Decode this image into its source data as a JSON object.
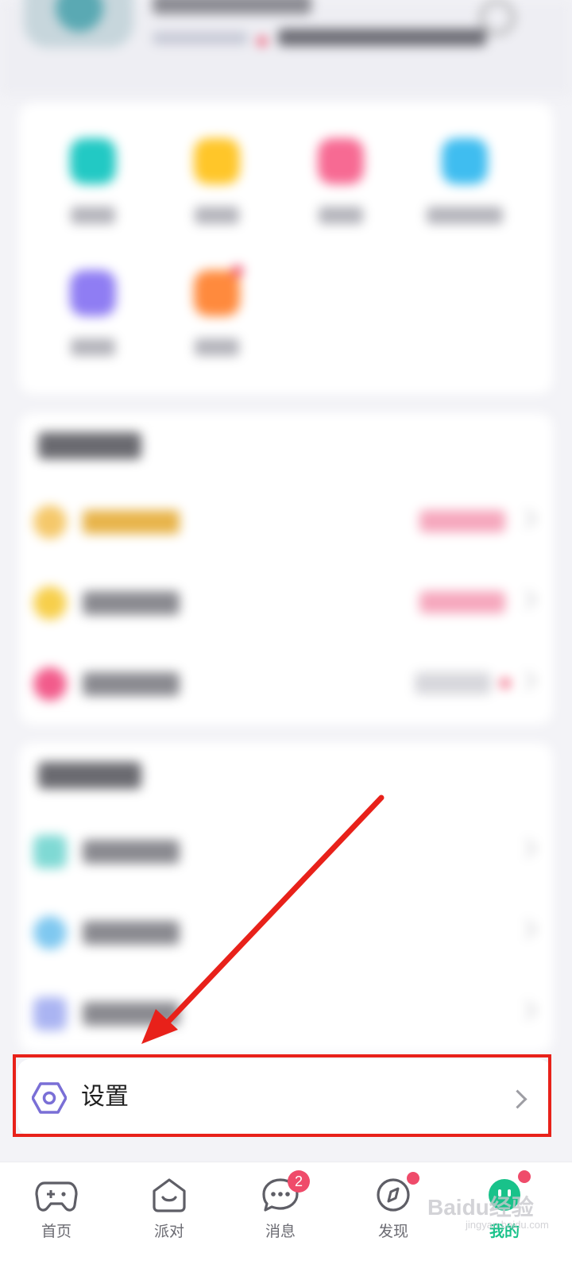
{
  "settings": {
    "label": "设置"
  },
  "tabs": [
    {
      "label": "首页",
      "icon": "gamepad-icon"
    },
    {
      "label": "派对",
      "icon": "party-icon"
    },
    {
      "label": "消息",
      "icon": "message-icon",
      "badge": "2"
    },
    {
      "label": "发现",
      "icon": "compass-icon",
      "dot": true
    },
    {
      "label": "我的",
      "icon": "profile-icon",
      "dot": true,
      "active": true
    }
  ],
  "watermark": {
    "text": "Baidu经验",
    "sub": "jingyan.baidu.com"
  },
  "colors": {
    "accent": "#19c28a",
    "annotation": "#e8211a",
    "badge": "#ef4b6a",
    "settings_icon": "#7a6fd6"
  }
}
